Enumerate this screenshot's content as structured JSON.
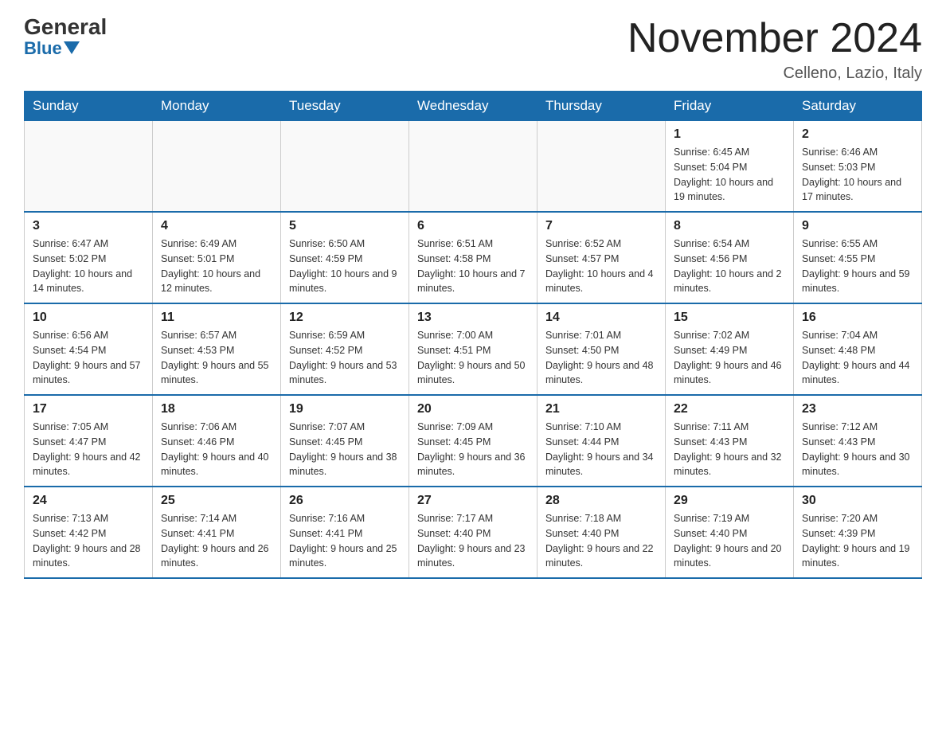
{
  "header": {
    "logo_general": "General",
    "logo_blue": "Blue",
    "month_title": "November 2024",
    "location": "Celleno, Lazio, Italy"
  },
  "days_of_week": [
    "Sunday",
    "Monday",
    "Tuesday",
    "Wednesday",
    "Thursday",
    "Friday",
    "Saturday"
  ],
  "weeks": [
    [
      {
        "day": "",
        "info": ""
      },
      {
        "day": "",
        "info": ""
      },
      {
        "day": "",
        "info": ""
      },
      {
        "day": "",
        "info": ""
      },
      {
        "day": "",
        "info": ""
      },
      {
        "day": "1",
        "info": "Sunrise: 6:45 AM\nSunset: 5:04 PM\nDaylight: 10 hours and 19 minutes."
      },
      {
        "day": "2",
        "info": "Sunrise: 6:46 AM\nSunset: 5:03 PM\nDaylight: 10 hours and 17 minutes."
      }
    ],
    [
      {
        "day": "3",
        "info": "Sunrise: 6:47 AM\nSunset: 5:02 PM\nDaylight: 10 hours and 14 minutes."
      },
      {
        "day": "4",
        "info": "Sunrise: 6:49 AM\nSunset: 5:01 PM\nDaylight: 10 hours and 12 minutes."
      },
      {
        "day": "5",
        "info": "Sunrise: 6:50 AM\nSunset: 4:59 PM\nDaylight: 10 hours and 9 minutes."
      },
      {
        "day": "6",
        "info": "Sunrise: 6:51 AM\nSunset: 4:58 PM\nDaylight: 10 hours and 7 minutes."
      },
      {
        "day": "7",
        "info": "Sunrise: 6:52 AM\nSunset: 4:57 PM\nDaylight: 10 hours and 4 minutes."
      },
      {
        "day": "8",
        "info": "Sunrise: 6:54 AM\nSunset: 4:56 PM\nDaylight: 10 hours and 2 minutes."
      },
      {
        "day": "9",
        "info": "Sunrise: 6:55 AM\nSunset: 4:55 PM\nDaylight: 9 hours and 59 minutes."
      }
    ],
    [
      {
        "day": "10",
        "info": "Sunrise: 6:56 AM\nSunset: 4:54 PM\nDaylight: 9 hours and 57 minutes."
      },
      {
        "day": "11",
        "info": "Sunrise: 6:57 AM\nSunset: 4:53 PM\nDaylight: 9 hours and 55 minutes."
      },
      {
        "day": "12",
        "info": "Sunrise: 6:59 AM\nSunset: 4:52 PM\nDaylight: 9 hours and 53 minutes."
      },
      {
        "day": "13",
        "info": "Sunrise: 7:00 AM\nSunset: 4:51 PM\nDaylight: 9 hours and 50 minutes."
      },
      {
        "day": "14",
        "info": "Sunrise: 7:01 AM\nSunset: 4:50 PM\nDaylight: 9 hours and 48 minutes."
      },
      {
        "day": "15",
        "info": "Sunrise: 7:02 AM\nSunset: 4:49 PM\nDaylight: 9 hours and 46 minutes."
      },
      {
        "day": "16",
        "info": "Sunrise: 7:04 AM\nSunset: 4:48 PM\nDaylight: 9 hours and 44 minutes."
      }
    ],
    [
      {
        "day": "17",
        "info": "Sunrise: 7:05 AM\nSunset: 4:47 PM\nDaylight: 9 hours and 42 minutes."
      },
      {
        "day": "18",
        "info": "Sunrise: 7:06 AM\nSunset: 4:46 PM\nDaylight: 9 hours and 40 minutes."
      },
      {
        "day": "19",
        "info": "Sunrise: 7:07 AM\nSunset: 4:45 PM\nDaylight: 9 hours and 38 minutes."
      },
      {
        "day": "20",
        "info": "Sunrise: 7:09 AM\nSunset: 4:45 PM\nDaylight: 9 hours and 36 minutes."
      },
      {
        "day": "21",
        "info": "Sunrise: 7:10 AM\nSunset: 4:44 PM\nDaylight: 9 hours and 34 minutes."
      },
      {
        "day": "22",
        "info": "Sunrise: 7:11 AM\nSunset: 4:43 PM\nDaylight: 9 hours and 32 minutes."
      },
      {
        "day": "23",
        "info": "Sunrise: 7:12 AM\nSunset: 4:43 PM\nDaylight: 9 hours and 30 minutes."
      }
    ],
    [
      {
        "day": "24",
        "info": "Sunrise: 7:13 AM\nSunset: 4:42 PM\nDaylight: 9 hours and 28 minutes."
      },
      {
        "day": "25",
        "info": "Sunrise: 7:14 AM\nSunset: 4:41 PM\nDaylight: 9 hours and 26 minutes."
      },
      {
        "day": "26",
        "info": "Sunrise: 7:16 AM\nSunset: 4:41 PM\nDaylight: 9 hours and 25 minutes."
      },
      {
        "day": "27",
        "info": "Sunrise: 7:17 AM\nSunset: 4:40 PM\nDaylight: 9 hours and 23 minutes."
      },
      {
        "day": "28",
        "info": "Sunrise: 7:18 AM\nSunset: 4:40 PM\nDaylight: 9 hours and 22 minutes."
      },
      {
        "day": "29",
        "info": "Sunrise: 7:19 AM\nSunset: 4:40 PM\nDaylight: 9 hours and 20 minutes."
      },
      {
        "day": "30",
        "info": "Sunrise: 7:20 AM\nSunset: 4:39 PM\nDaylight: 9 hours and 19 minutes."
      }
    ]
  ]
}
